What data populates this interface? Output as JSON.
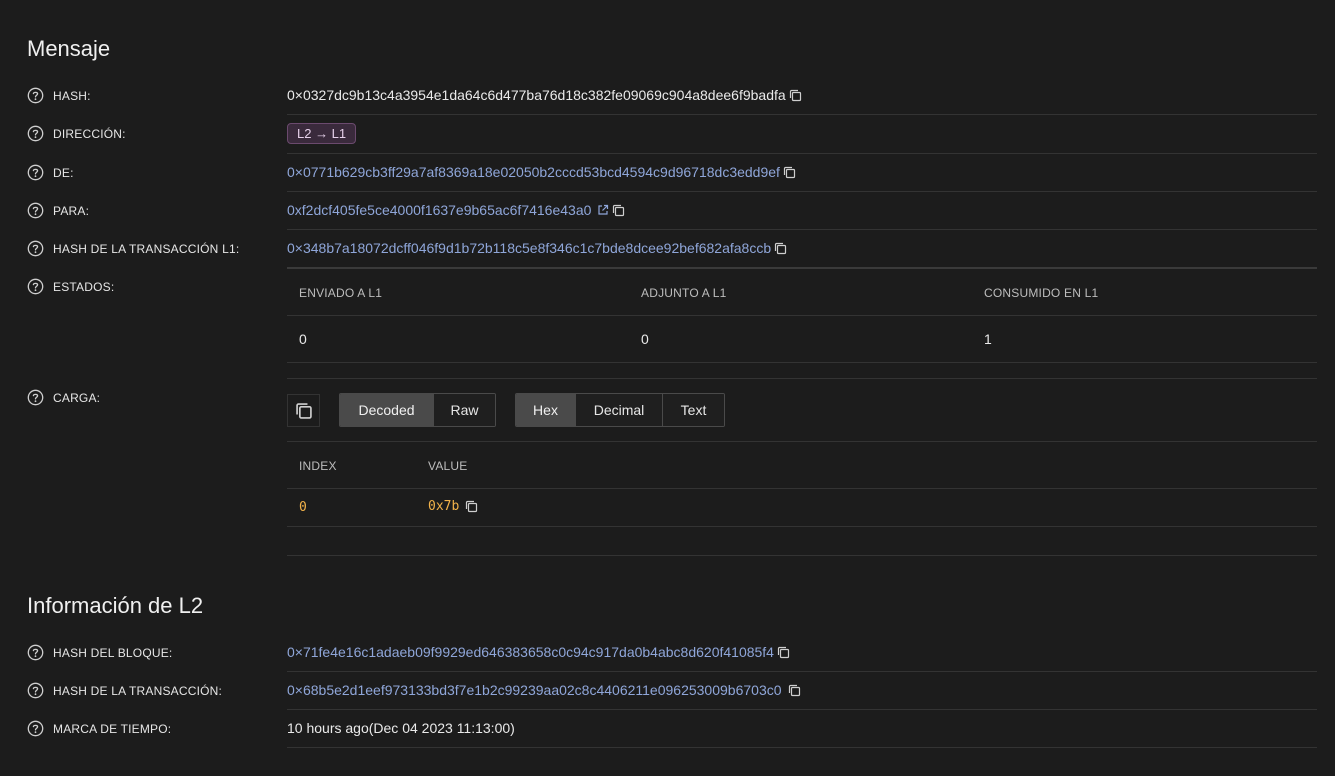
{
  "message": {
    "title": "Mensaje",
    "hash_label": "HASH:",
    "hash_value": "0×0327dc9b13c4a3954e1da64c6d477ba76d18c382fe09069c904a8dee6f9badfa",
    "direction_label": "DIRECCIÓN:",
    "direction_value": "L2 → L1",
    "from_label": "DE:",
    "from_value": "0×0771b629cb3ff29a7af8369a18e02050b2cccd53bcd4594c9d96718dc3edd9ef",
    "to_label": "PARA:",
    "to_value": "0xf2dcf405fe5ce4000f1637e9b65ac6f7416e43a0",
    "l1_tx_label": "HASH DE LA TRANSACCIÓN L1:",
    "l1_tx_value": "0×348b7a18072dcff046f9d1b72b118c5e8f346c1c7bde8dcee92bef682afa8ccb",
    "states_label": "ESTADOS:",
    "states": {
      "headers": [
        "ENVIADO A L1",
        "ADJUNTO A L1",
        "CONSUMIDO EN L1"
      ],
      "values": [
        "0",
        "0",
        "1"
      ]
    },
    "payload_label": "CARGA:",
    "payload_modes": [
      "Decoded",
      "Raw"
    ],
    "payload_modes_active": "Decoded",
    "payload_formats": [
      "Hex",
      "Decimal",
      "Text"
    ],
    "payload_formats_active": "Hex",
    "payload_table": {
      "headers": [
        "INDEX",
        "VALUE"
      ],
      "rows": [
        {
          "index": "0",
          "value": "0x7b"
        }
      ]
    }
  },
  "l2": {
    "title": "Información de L2",
    "block_hash_label": "HASH DEL BLOQUE:",
    "block_hash_value": "0×71fe4e16c1adaeb09f9929ed646383658c0c94c917da0b4abc8d620f41085f4",
    "tx_hash_label": "HASH DE LA TRANSACCIÓN:",
    "tx_hash_value": "0×68b5e2d1eef973133bd3f7e1b2c99239aa02c8c4406211e096253009b6703c0",
    "timestamp_label": "MARCA DE TIEMPO:",
    "timestamp_value": "10 hours ago",
    "timestamp_date": "Dec 04 2023 11:13:00"
  },
  "icons": {
    "help": "question-circle-icon",
    "copy": "copy-icon",
    "external": "external-link-icon"
  },
  "colors": {
    "background": "#1c1c1c",
    "link": "#8fa6d9",
    "payload_value": "#f2b24a",
    "badge_bg": "#3a2a3c"
  }
}
